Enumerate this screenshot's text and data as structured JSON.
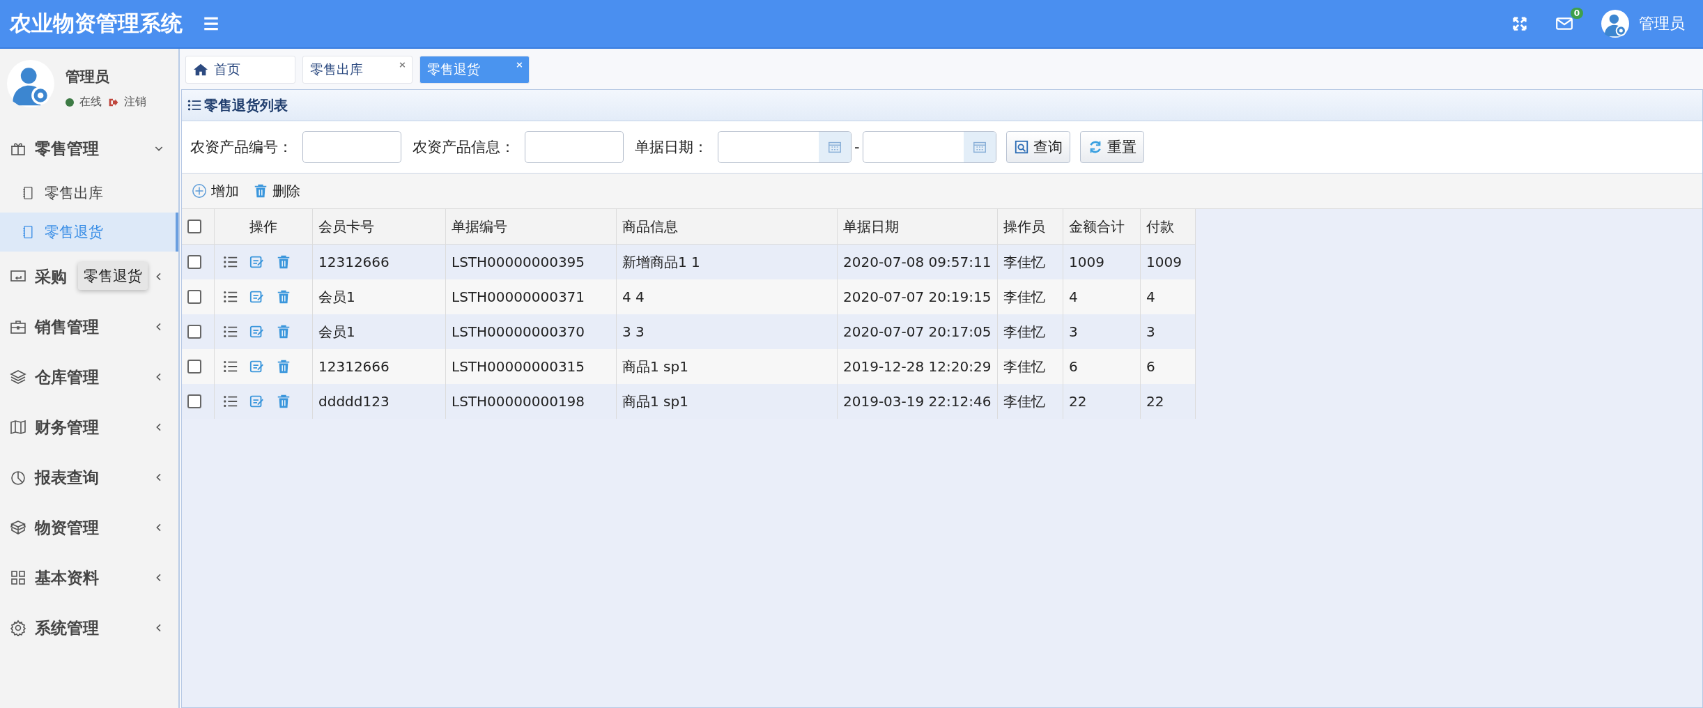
{
  "header": {
    "title": "农业物资管理系统",
    "mail_badge": "0",
    "user": "管理员"
  },
  "user_panel": {
    "name": "管理员",
    "status": "在线",
    "logout": "注销"
  },
  "menu": [
    {
      "label": "零售管理",
      "expanded": true,
      "children": [
        {
          "label": "零售出库",
          "selected": false
        },
        {
          "label": "零售退货",
          "selected": true
        }
      ]
    },
    {
      "label": "采购",
      "expanded": false
    },
    {
      "label": "销售管理",
      "expanded": false
    },
    {
      "label": "仓库管理",
      "expanded": false
    },
    {
      "label": "财务管理",
      "expanded": false
    },
    {
      "label": "报表查询",
      "expanded": false
    },
    {
      "label": "物资管理",
      "expanded": false
    },
    {
      "label": "基本资料",
      "expanded": false
    },
    {
      "label": "系统管理",
      "expanded": false
    }
  ],
  "tooltip": "零售退货",
  "tabs": [
    {
      "label": "首页",
      "selected": false
    },
    {
      "label": "零售出库",
      "selected": false,
      "close": "×"
    },
    {
      "label": "零售退货",
      "selected": true,
      "close": "×"
    }
  ],
  "panel": {
    "title": "零售退货列表"
  },
  "filters": [
    {
      "label": "农资产品编号：",
      "kind": "text"
    },
    {
      "label": "农资产品信息：",
      "kind": "text"
    },
    {
      "label": "单据日期：",
      "kind": "daterange",
      "separator": "-"
    }
  ],
  "search_buttons": [
    "查询",
    "重置"
  ],
  "toolbar": [
    "增加",
    "删除"
  ],
  "table": {
    "columns": [
      "操作",
      "会员卡号",
      "单据编号",
      "商品信息",
      "单据日期",
      "操作员",
      "金额合计",
      "付款"
    ],
    "select_all": false,
    "rows": [
      {
        "checked": false,
        "cells": [
          "",
          "12312666",
          "LSTH00000000395",
          "新增商品1 1",
          "2020-07-08 09:57:11",
          "李佳忆",
          "1009",
          "1009"
        ]
      },
      {
        "checked": false,
        "cells": [
          "",
          "会员1",
          "LSTH00000000371",
          "4 4",
          "2020-07-07 20:19:15",
          "李佳忆",
          "4",
          "4"
        ]
      },
      {
        "checked": false,
        "cells": [
          "",
          "会员1",
          "LSTH00000000370",
          "3 3",
          "2020-07-07 20:17:05",
          "李佳忆",
          "3",
          "3"
        ]
      },
      {
        "checked": false,
        "cells": [
          "",
          "12312666",
          "LSTH00000000315",
          "商品1 sp1",
          "2019-12-28 12:20:29",
          "李佳忆",
          "6",
          "6"
        ]
      },
      {
        "checked": false,
        "cells": [
          "",
          "ddddd123",
          "LSTH00000000198",
          "商品1 sp1",
          "2019-03-19 22:12:46",
          "李佳忆",
          "22",
          "22"
        ]
      }
    ]
  }
}
